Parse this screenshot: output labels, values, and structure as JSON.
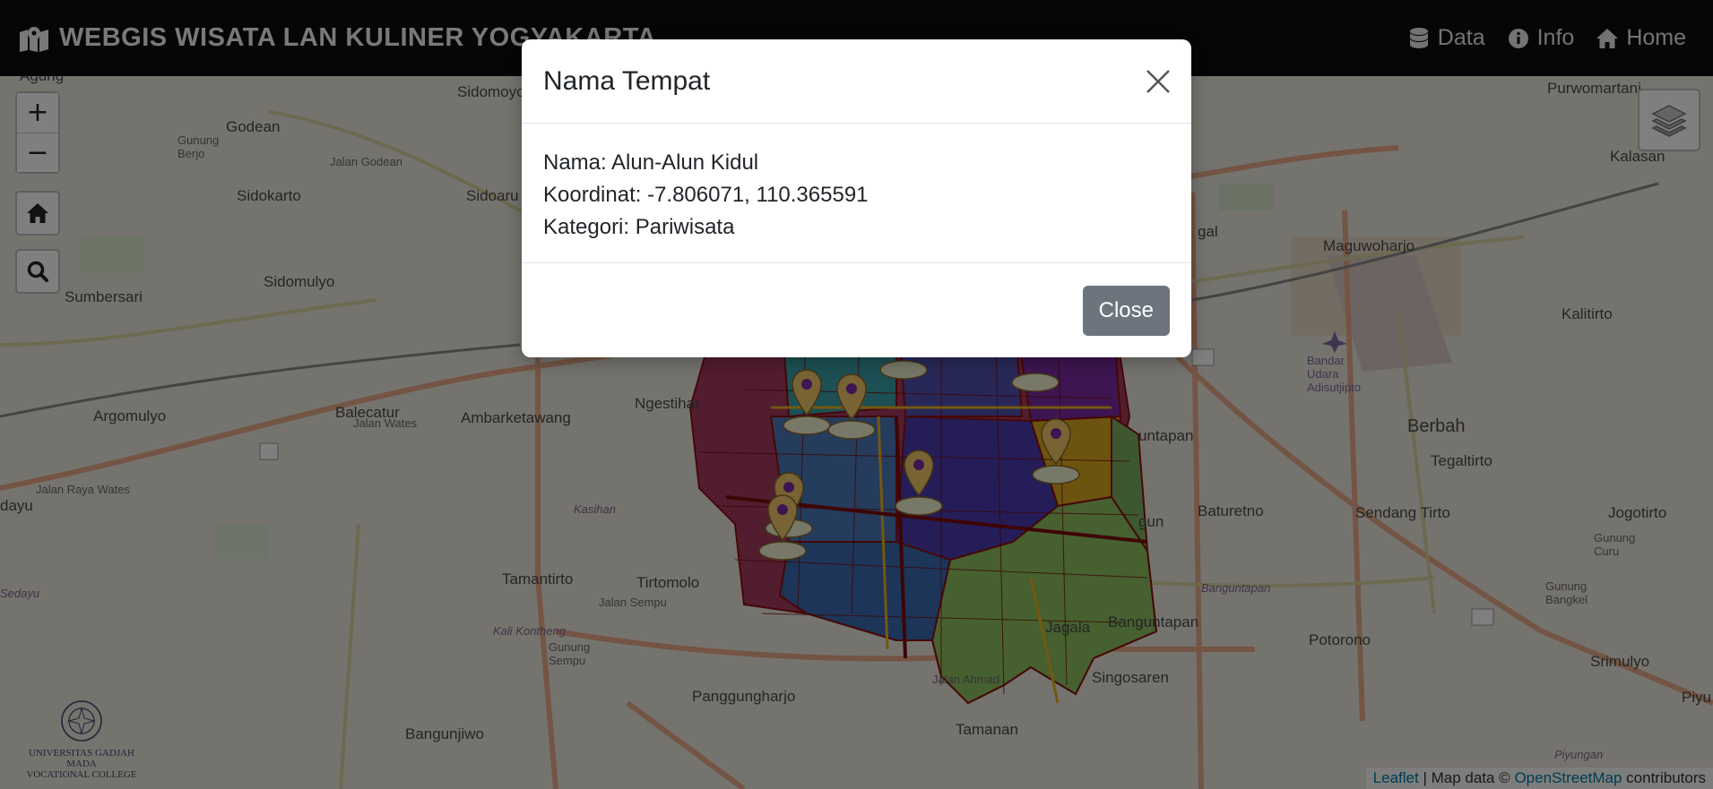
{
  "app": {
    "title": "WEBGIS WISATA LAN KULINER YOGYAKARTA",
    "nav": [
      {
        "label": "Data",
        "icon": "database-icon"
      },
      {
        "label": "Info",
        "icon": "info-circle-icon"
      },
      {
        "label": "Home",
        "icon": "house-icon"
      }
    ]
  },
  "map": {
    "controls": {
      "zoom_in": "+",
      "zoom_out": "−"
    },
    "labels": {
      "godean": "Godean",
      "sidomoyo": "Sidomoyo",
      "gunung_berjo": "Gunung\nBerjo",
      "sidokarto": "Sidokarto",
      "sidoarum": "Sidoaru",
      "sumbersari": "Sumbersari",
      "sidomulyo": "Sidomulyo",
      "argomulyo": "Argomulyo",
      "balecatur": "Balecatur",
      "ambarketawang": "Ambarketawang",
      "ngestiharjo": "Ngestihar",
      "dayu": "dayu",
      "sedayu": "Sedayu",
      "tamantirto": "Tamantirto",
      "tirtomolo": "Tirtomolo",
      "kasihan": "Kasihan",
      "gunung_sempu": "Gunung\nSempu",
      "panggungharjo": "Panggungharjo",
      "bangunjiwo": "Bangunjiwo",
      "tamanan": "Tamanan",
      "singosaren": "Singosaren",
      "jagalan": "Jagala",
      "banguntapan": "Banguntapan",
      "banguntapan_italic": "Banguntapan",
      "baturetno": "Baturetno",
      "potorono": "Potorono",
      "sendang_tirto": "Sendang Tirto",
      "tegaltirto": "Tegaltirto",
      "berbah": "Berbah",
      "jogotirto": "Jogotirto",
      "kalitirto": "Kalitirto",
      "maguwoharjo": "Maguwoharjo",
      "purwomartani": "Purwomartani",
      "kalasan": "Kalasan",
      "srimulyo": "Srimulyo",
      "gunung_curu": "Gunung\nCuru",
      "gunung_bangkel": "Gunung\nBangkel",
      "piyungan": "Piyungan",
      "piyu": "Piyu",
      "bandar_udara": "Bandar\nUdara\nAdisutjipto",
      "agung": "Agung",
      "gal": "gal",
      "untapan": "untapan",
      "gun": "gun",
      "jalan_godean": "Jalan Godean",
      "jalan_wates": "Jalan Wates",
      "jalan_raya_wates": "Jalan Raya Wates",
      "koli_kontheng": "Kali Kontheng",
      "jalan_sempu": "Jalan Sempu",
      "jalan_ahmad": "Jalan Ahmad"
    },
    "logo": {
      "line1": "UNIVERSITAS GADJAH MADA",
      "line2": "VOCATIONAL COLLEGE"
    },
    "attribution": {
      "leaflet": "Leaflet",
      "sep": " | Map data © ",
      "osm": "OpenStreetMap",
      "tail": " contributors"
    }
  },
  "modal": {
    "title": "Nama Tempat",
    "nama": "Nama: Alun-Alun Kidul",
    "koordinat": "Koordinat: -7.806071, 110.365591",
    "kategori": "Kategori: Pariwisata",
    "close_label": "Close"
  }
}
